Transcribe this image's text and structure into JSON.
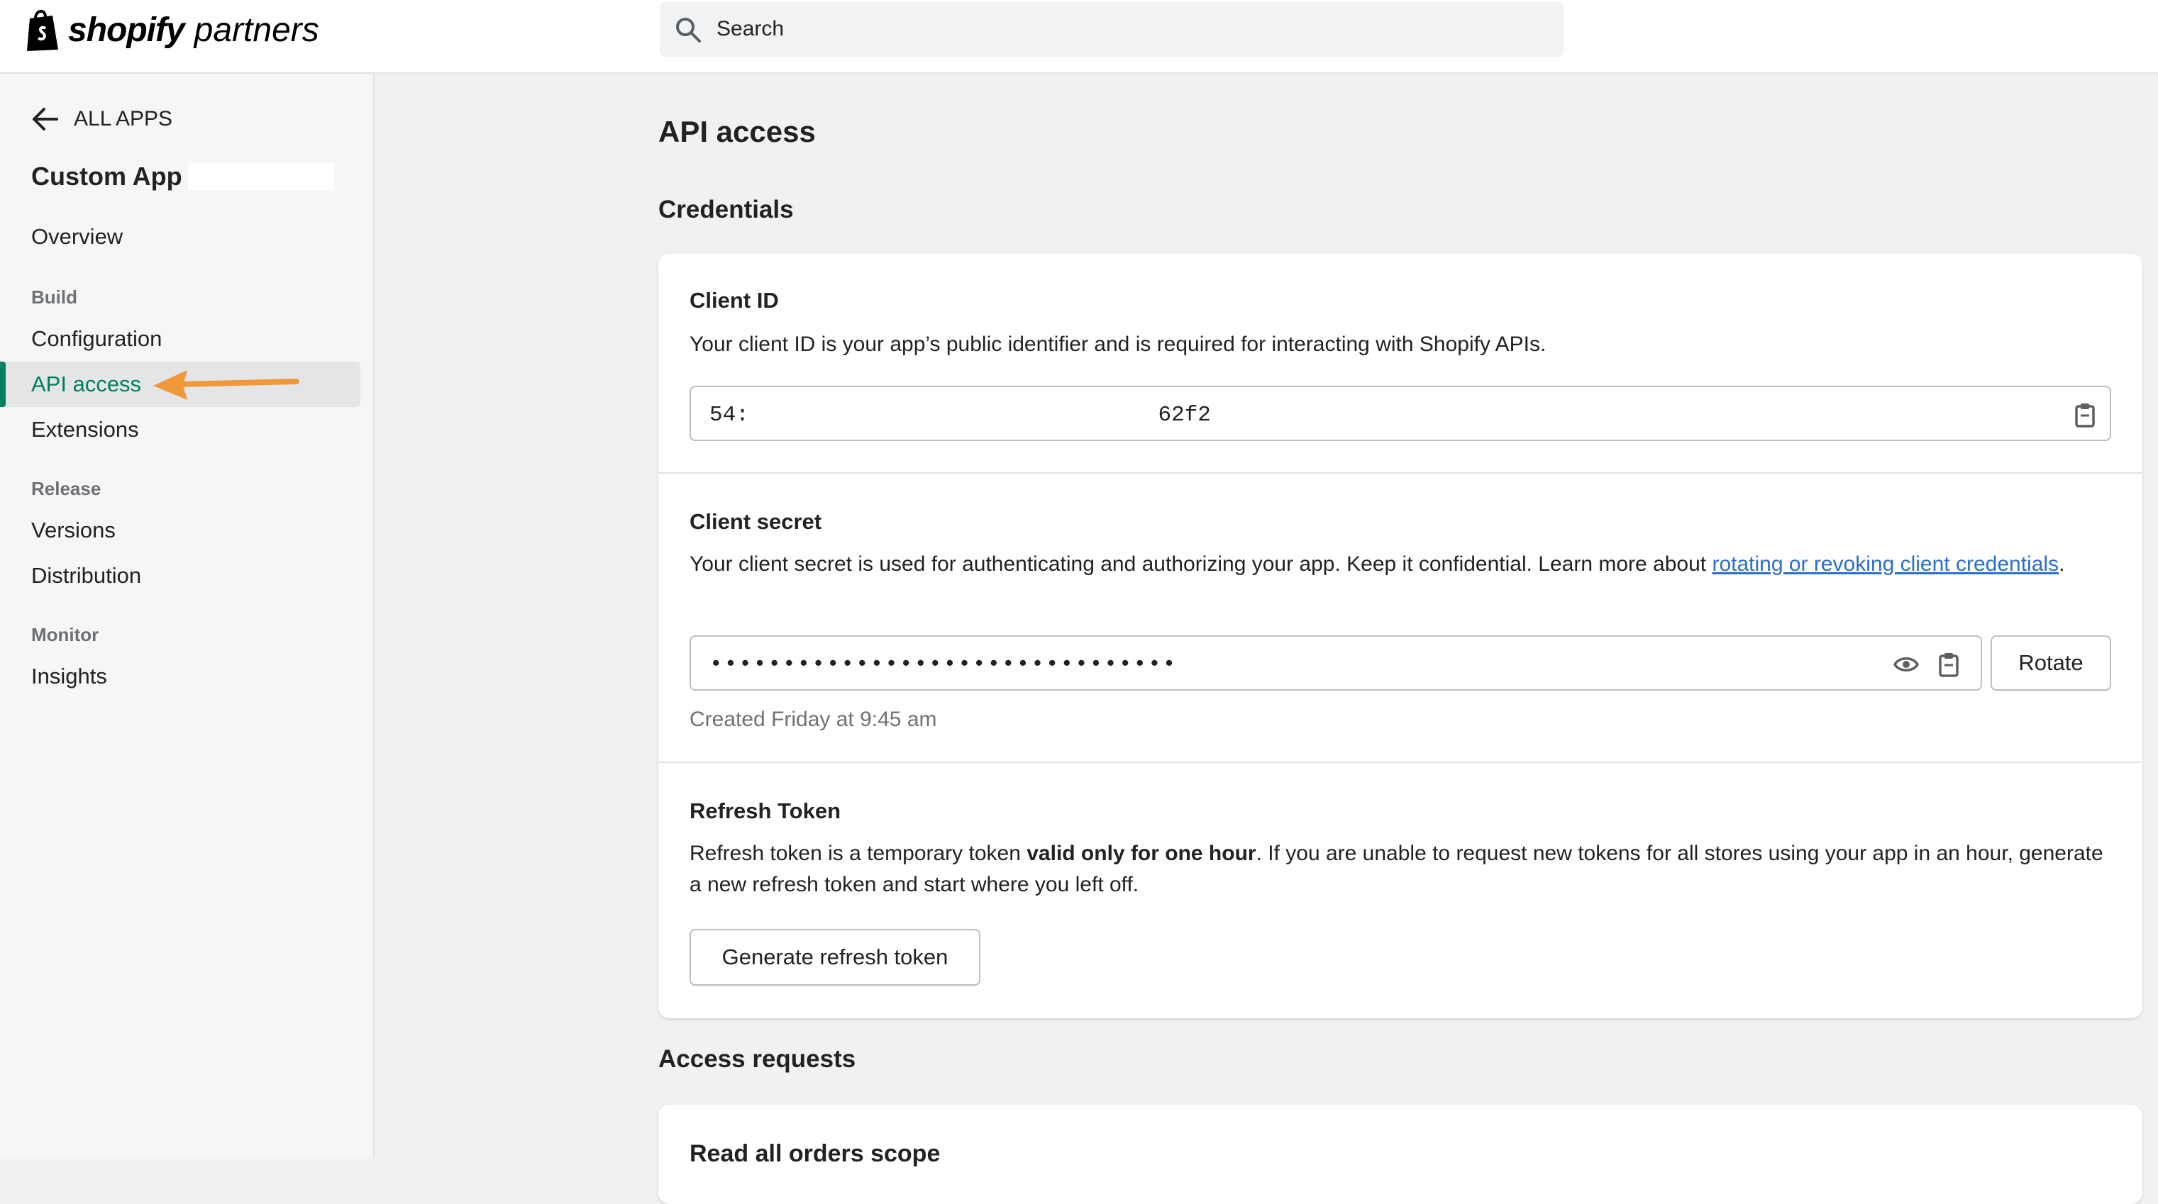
{
  "header": {
    "logo_bold": "shopify",
    "logo_light": "partners",
    "search_placeholder": "Search"
  },
  "sidebar": {
    "back_label": "ALL APPS",
    "app_name": "Custom App",
    "overview": "Overview",
    "sections": {
      "build": "Build",
      "release": "Release",
      "monitor": "Monitor"
    },
    "items": {
      "configuration": "Configuration",
      "api_access": "API access",
      "extensions": "Extensions",
      "versions": "Versions",
      "distribution": "Distribution",
      "insights": "Insights"
    },
    "active_item": "API access"
  },
  "main": {
    "page_title": "API access",
    "credentials_title": "Credentials",
    "client_id": {
      "title": "Client ID",
      "description": "Your client ID is your app’s public identifier and is required for interacting with Shopify APIs.",
      "value": "54:                               62f2"
    },
    "client_secret": {
      "title": "Client secret",
      "description_before": "Your client secret is used for authenticating and authorizing your app. Keep it confidential. Learn more about ",
      "link_text": "rotating or revoking client credentials",
      "description_after": ".",
      "masked_value": "••••••••••••••••••••••••••••••••",
      "rotate_label": "Rotate",
      "created": "Created Friday at 9:45 am"
    },
    "refresh_token": {
      "title": "Refresh Token",
      "description_before": "Refresh token is a temporary token ",
      "description_bold": "valid only for one hour",
      "description_after": ". If you are unable to request new tokens for all stores using your app in an hour, generate a new refresh token and start where you left off.",
      "button_label": "Generate refresh token"
    },
    "access_requests_title": "Access requests",
    "access_requests_first_card": "Read all orders scope"
  },
  "colors": {
    "accent_green": "#008060",
    "link_blue": "#2c6ecb",
    "annotation_arrow": "#f0983a"
  }
}
